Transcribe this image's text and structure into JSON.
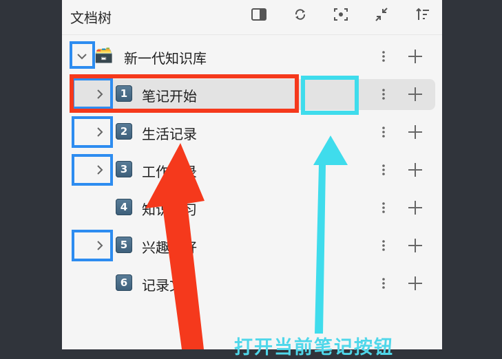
{
  "header": {
    "title": "文档树",
    "icons": [
      "sidebar-toggle-icon",
      "refresh-icon",
      "focus-icon",
      "collapse-icon",
      "sort-icon"
    ]
  },
  "tree": {
    "root": {
      "label": "新一代知识库",
      "icon": "🗃️",
      "expanded": true
    },
    "items": [
      {
        "num": "1",
        "label": "笔记开始",
        "has_children": true,
        "selected": true
      },
      {
        "num": "2",
        "label": "生活记录",
        "has_children": true
      },
      {
        "num": "3",
        "label": "工作记录",
        "has_children": true
      },
      {
        "num": "4",
        "label": "知识学习",
        "has_children": false
      },
      {
        "num": "5",
        "label": "兴趣爱好",
        "has_children": true
      },
      {
        "num": "6",
        "label": "记录文档",
        "has_children": false
      }
    ]
  },
  "annotation": {
    "caption": "打开当前笔记按钮",
    "colors": {
      "red": "#f5391c",
      "cyan": "#3fdcec",
      "blue": "#2d8cf0"
    }
  }
}
